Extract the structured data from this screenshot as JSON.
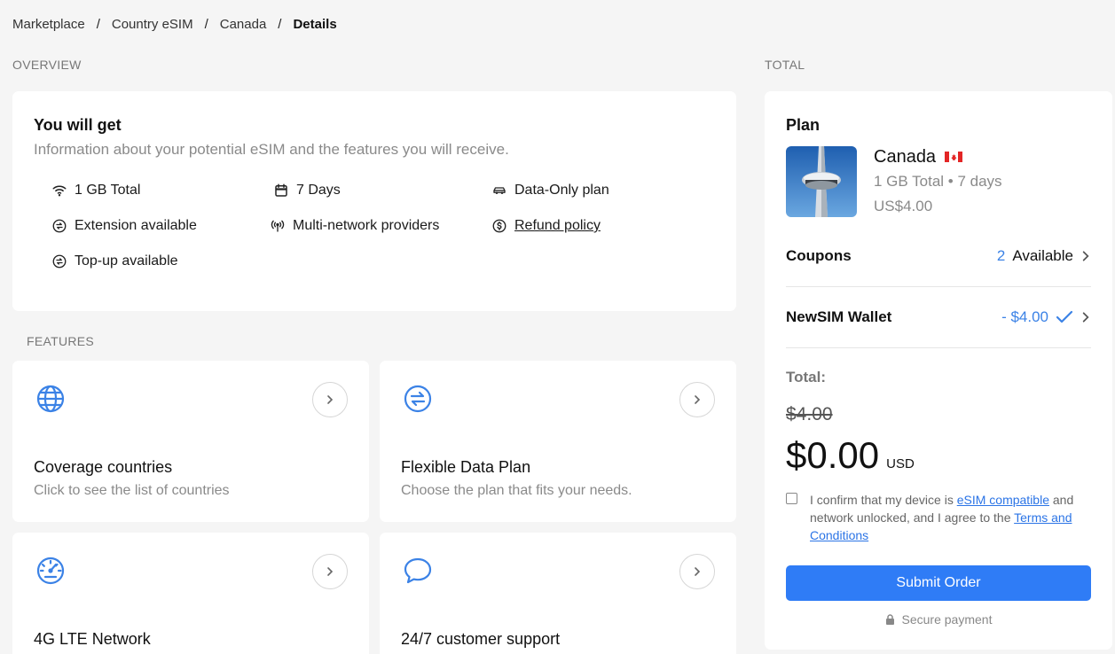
{
  "breadcrumb": [
    "Marketplace",
    "Country eSIM",
    "Canada",
    "Details"
  ],
  "overview": {
    "section_label": "OVERVIEW",
    "title": "You will get",
    "subtitle": "Information about your potential eSIM and the features you will receive.",
    "features": {
      "data": "1 GB Total",
      "days": "7 Days",
      "plan_type": "Data-Only plan",
      "extension": "Extension available",
      "multi_network": "Multi-network providers",
      "refund": "Refund policy",
      "topup": "Top-up available"
    }
  },
  "features_section": {
    "label": "FEATURES",
    "cards": [
      {
        "title": "Coverage countries",
        "subtitle": "Click to see the list of countries",
        "icon": "globe-icon"
      },
      {
        "title": "Flexible Data Plan",
        "subtitle": "Choose the plan that fits your needs.",
        "icon": "swap-icon"
      },
      {
        "title": "4G LTE Network",
        "subtitle": "",
        "icon": "speedometer-icon"
      },
      {
        "title": "24/7 customer support",
        "subtitle": "",
        "icon": "chat-bubble-icon"
      }
    ]
  },
  "total": {
    "section_label": "TOTAL",
    "plan_heading": "Plan",
    "country": "Canada",
    "flag": "🇨🇦",
    "meta": "1 GB Total • 7 days",
    "price": "US$4.00",
    "coupons_label": "Coupons",
    "coupons_count": "2",
    "coupons_text": "Available",
    "wallet_label": "NewSIM Wallet",
    "wallet_value": "- $4.00",
    "total_label": "Total:",
    "old_price": "$4.00",
    "new_price": "$0.00",
    "currency": "USD",
    "confirm_text_1": "I confirm that my device is ",
    "confirm_link_1": "eSIM compatible",
    "confirm_text_2": " and network unlocked, and I agree to the ",
    "confirm_link_2": "Terms and Conditions",
    "submit_label": "Submit Order",
    "secure_label": "Secure payment"
  },
  "colors": {
    "accent": "#2f7cf6",
    "icon_blue": "#3b82e6",
    "muted": "#8a8a8a"
  }
}
